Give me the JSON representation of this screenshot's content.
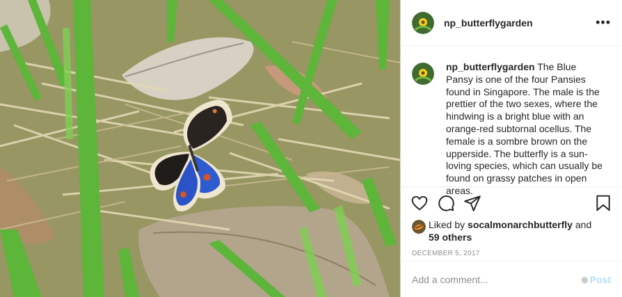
{
  "post": {
    "username": "np_butterflygarden",
    "more_icon": "more-horizontal-icon",
    "caption": {
      "username": "np_butterflygarden",
      "text": "The Blue Pansy is one of the four Pansies found in Singapore. The male is the prettier of the two sexes, where the hindwing is a bright blue with an orange-red subtornal ocellus. The female is a sombre brown on the upperside. The butterfly is a sun-loving species, which can usually be found on grassy patches in open areas."
    },
    "actions": {
      "like_icon": "heart-icon",
      "comment_icon": "comment-icon",
      "share_icon": "paper-plane-icon",
      "save_icon": "bookmark-icon"
    },
    "likes": {
      "prefix": "Liked by",
      "liker": "socalmonarchbutterfly",
      "joiner": "and",
      "others": "59 others"
    },
    "date": "DECEMBER 5, 2017",
    "comment": {
      "placeholder": "Add a comment...",
      "post_label": "Post"
    },
    "colors": {
      "text": "#262626",
      "muted": "#8e8e8e",
      "post_disabled": "#b2dffc",
      "divider": "#efefef"
    }
  }
}
